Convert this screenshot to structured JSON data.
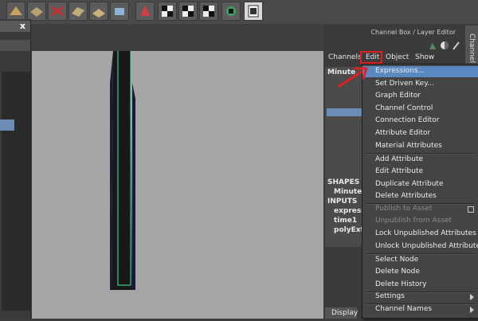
{
  "channel_box": {
    "title": "Channel Box / Layer Editor",
    "side_tab": "Channel B",
    "menus": [
      "Channels",
      "Edit",
      "Object",
      "Show"
    ],
    "node_title": "Minute",
    "sections": {
      "shapes": "SHAPES",
      "shape_node": "MinuteS",
      "inputs": "INPUTS",
      "input_nodes": [
        "express",
        "time1",
        "polyExt"
      ]
    },
    "display_tab": "Display"
  },
  "edit_menu": {
    "items": [
      {
        "label": "Expressions...",
        "highlighted": true
      },
      {
        "label": "Set Driven Key..."
      },
      {
        "label": "Graph Editor"
      },
      {
        "label": "Channel Control"
      },
      {
        "label": "Connection Editor"
      },
      {
        "label": "Attribute Editor"
      },
      {
        "label": "Material Attributes"
      },
      {
        "label": "Add Attribute"
      },
      {
        "label": "Edit Attribute"
      },
      {
        "label": "Duplicate Attribute"
      },
      {
        "label": "Delete Attributes"
      },
      {
        "label": "Publish to Asset",
        "disabled": true
      },
      {
        "label": "Unpublish from Asset",
        "disabled": true
      },
      {
        "label": "Lock Unpublished Attributes"
      },
      {
        "label": "Unlock Unpublished Attributes"
      },
      {
        "label": "Select Node"
      },
      {
        "label": "Delete Node"
      },
      {
        "label": "Delete History"
      },
      {
        "label": "Settings"
      },
      {
        "label": "Channel Names"
      }
    ]
  },
  "left_panel": {
    "close": "x"
  },
  "colors": {
    "highlight": "#5a88c0",
    "annotation": "#e02020",
    "viewport": "#a5a5a5",
    "wireframe": "#3ef0a0"
  }
}
